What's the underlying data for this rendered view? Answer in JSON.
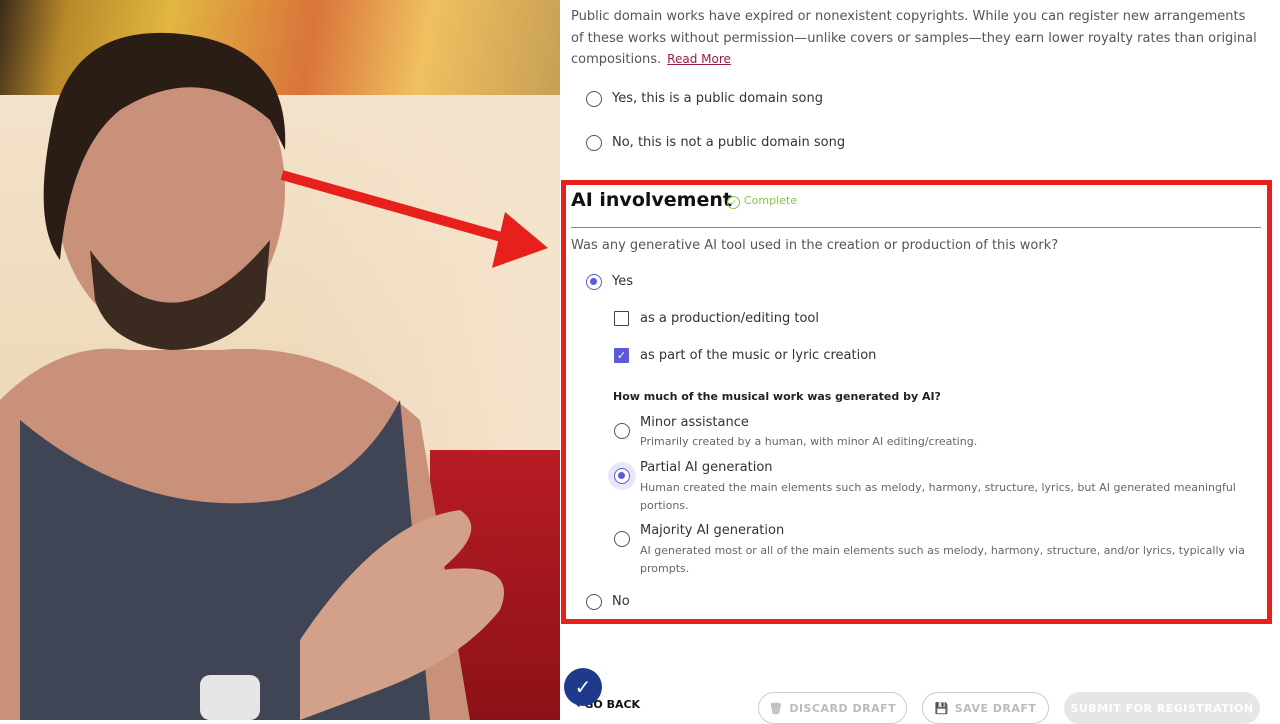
{
  "intro": {
    "text": "Public domain works have expired or nonexistent copyrights. While you can register new arrangements of these works without permission—unlike covers or samples—they earn lower royalty rates than original compositions.",
    "link": "Read More"
  },
  "public_domain": {
    "yes_label": "Yes, this is a public domain song",
    "no_label": "No, this is not a public domain song"
  },
  "ai_section": {
    "title": "AI involvement",
    "status": "Complete",
    "question": "Was any generative AI tool used in the creation or production of this work?",
    "yes_label": "Yes",
    "no_label": "No",
    "yes_selected": true,
    "checkboxes": [
      {
        "label": "as a production/editing tool",
        "checked": false
      },
      {
        "label": "as part of the music or lyric creation",
        "checked": true
      }
    ],
    "sub_question": "How much of the musical work was generated by AI?",
    "levels": [
      {
        "label": "Minor assistance",
        "desc": "Primarily created by a human, with minor AI editing/creating.",
        "selected": false
      },
      {
        "label": "Partial AI generation",
        "desc": "Human created the main elements such as melody, harmony, structure, lyrics, but AI generated meaningful portions.",
        "selected": true
      },
      {
        "label": "Majority AI generation",
        "desc": "AI generated most or all of the main elements such as melody, harmony, structure, and/or lyrics, typically via prompts.",
        "selected": false
      }
    ]
  },
  "footer": {
    "go_back": "GO BACK",
    "discard": "DISCARD DRAFT",
    "save": "SAVE DRAFT",
    "submit": "SUBMIT FOR REGISTRATION"
  },
  "colors": {
    "accent": "#5b5bd6",
    "highlight": "#e8201c",
    "complete": "#8bc34a",
    "link": "#9b1c3a"
  }
}
